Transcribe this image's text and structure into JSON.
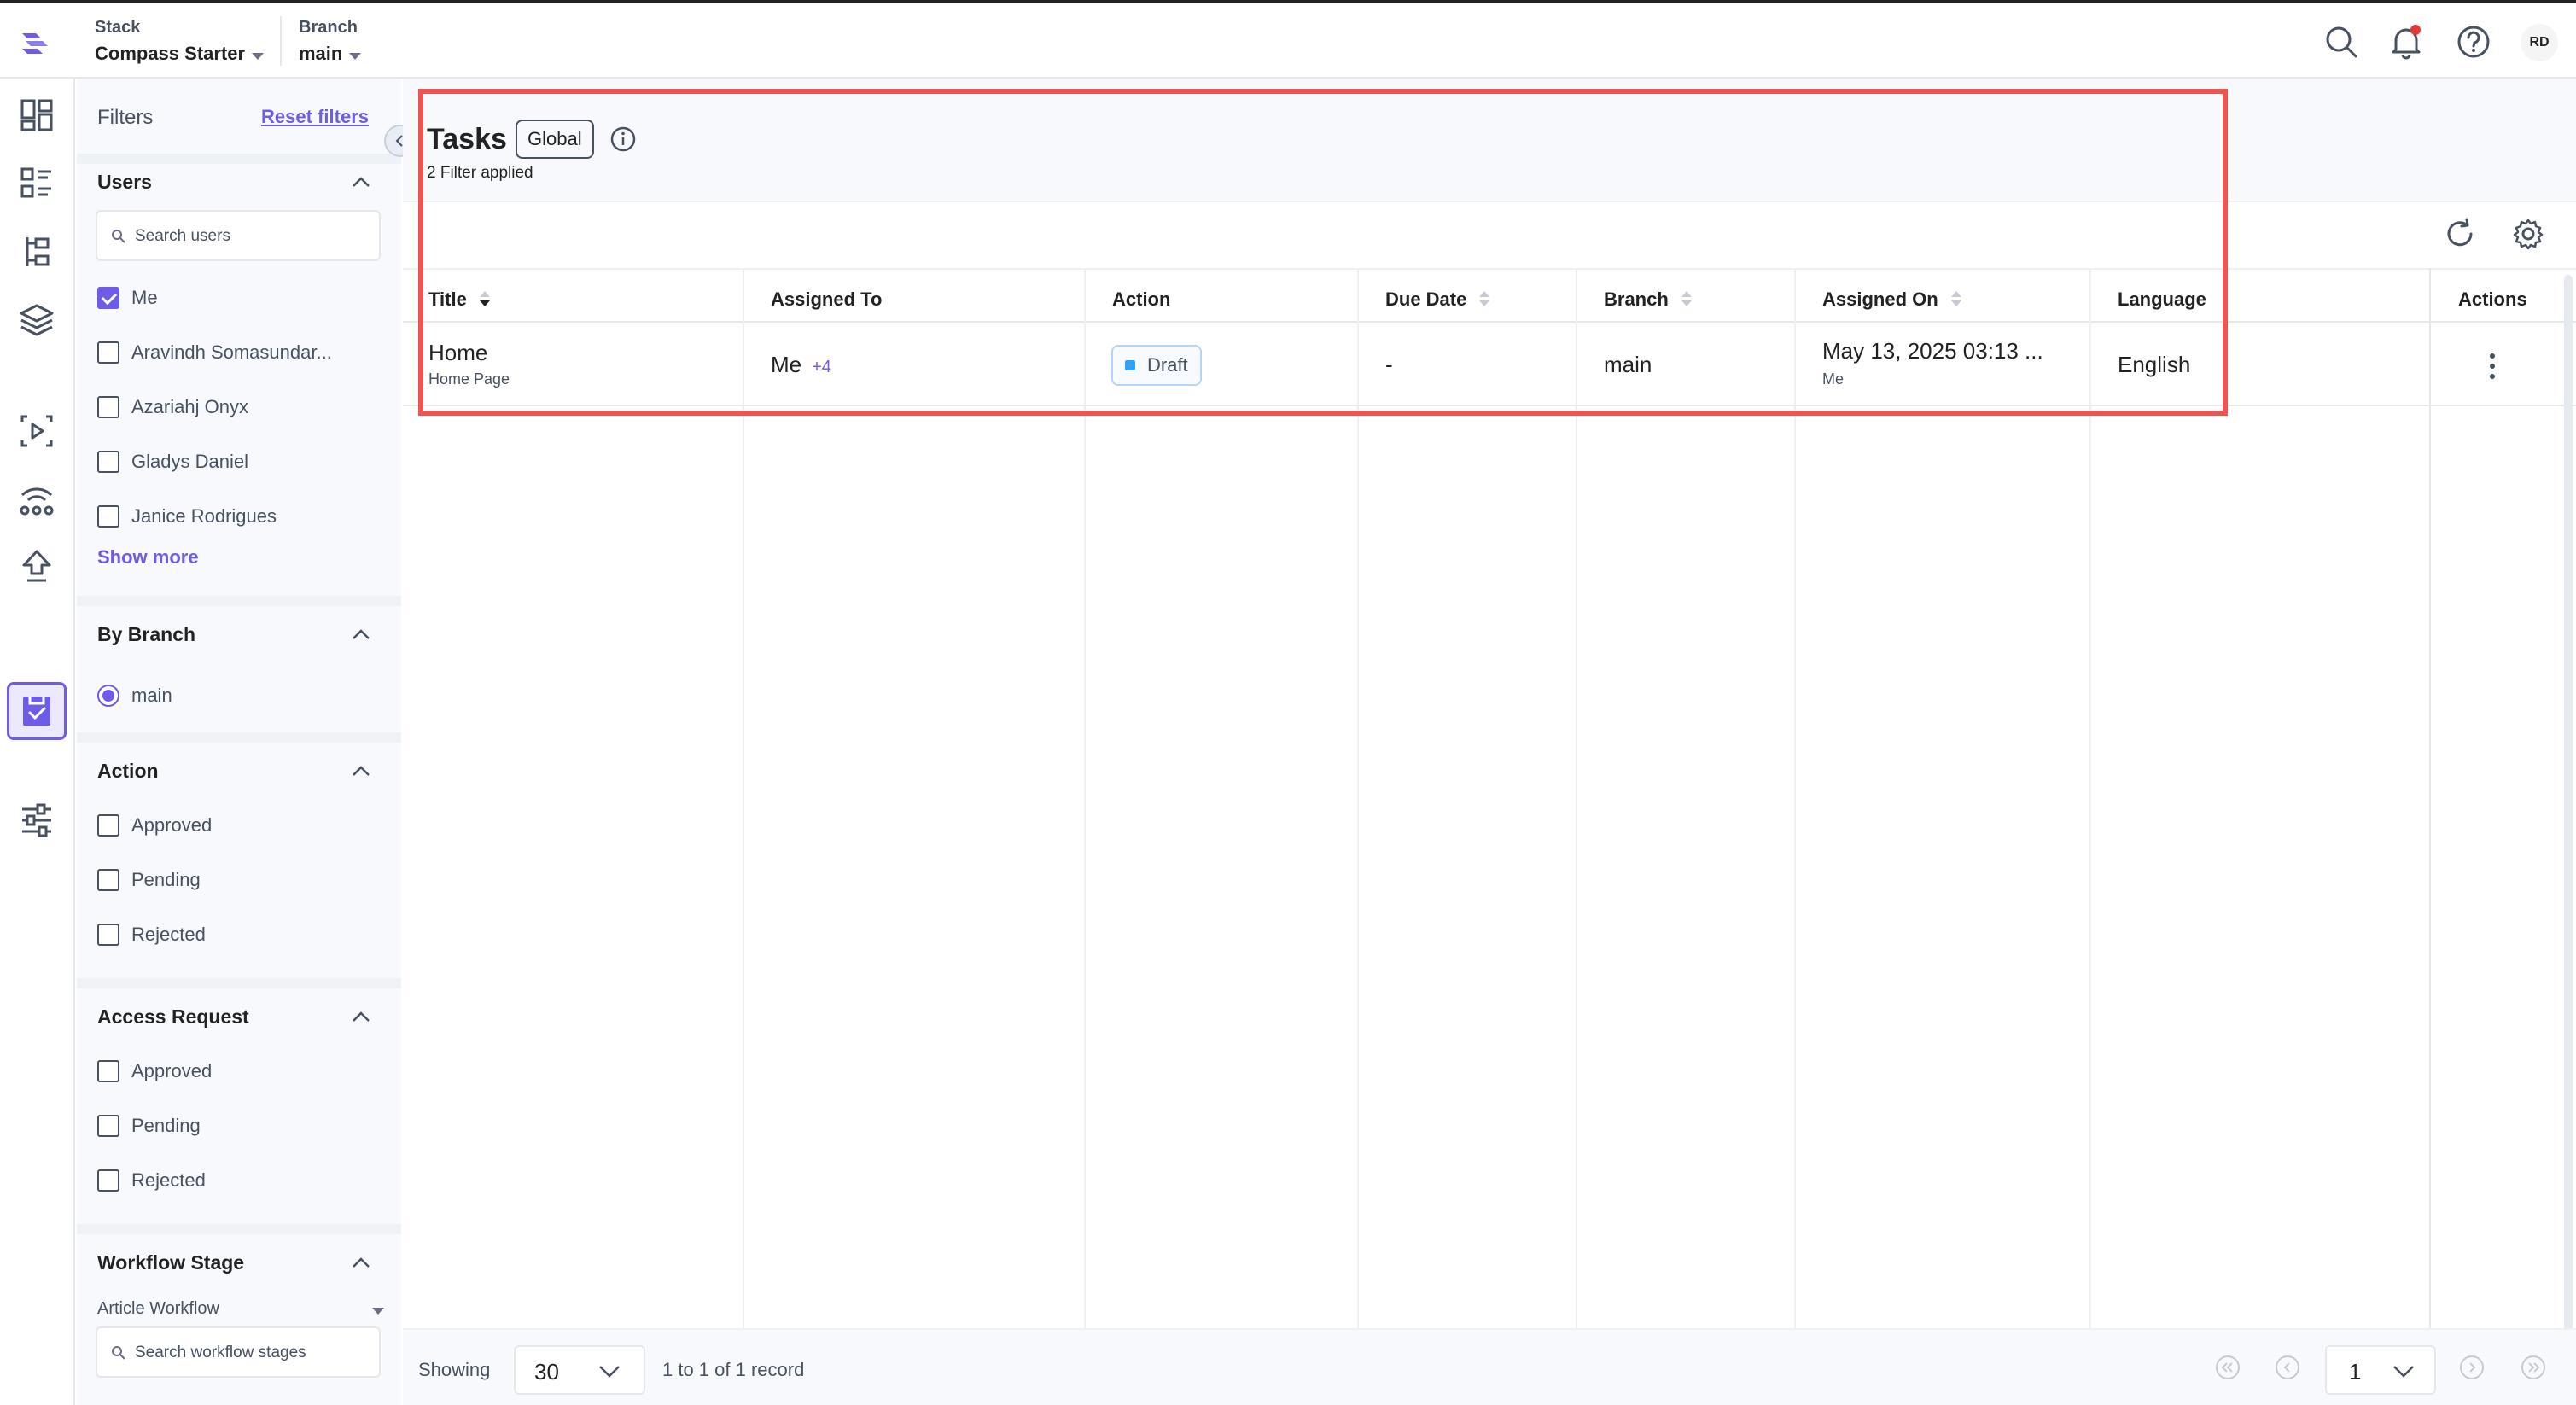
{
  "header": {
    "stack_label": "Stack",
    "stack_value": "Compass Starter",
    "branch_label": "Branch",
    "branch_value": "main",
    "avatar_initials": "RD",
    "notification_dot_color": "#e53935"
  },
  "filters": {
    "title": "Filters",
    "reset_label": "Reset filters",
    "users": {
      "title": "Users",
      "search_placeholder": "Search users",
      "items": [
        {
          "label": "Me",
          "checked": true
        },
        {
          "label": "Aravindh Somasundar...",
          "checked": false
        },
        {
          "label": "Azariahj Onyx",
          "checked": false
        },
        {
          "label": "Gladys Daniel",
          "checked": false
        },
        {
          "label": "Janice Rodrigues",
          "checked": false
        }
      ],
      "show_more": "Show more"
    },
    "by_branch": {
      "title": "By Branch",
      "items": [
        {
          "label": "main",
          "selected": true
        }
      ]
    },
    "action": {
      "title": "Action",
      "items": [
        {
          "label": "Approved"
        },
        {
          "label": "Pending"
        },
        {
          "label": "Rejected"
        }
      ]
    },
    "access_request": {
      "title": "Access Request",
      "items": [
        {
          "label": "Approved"
        },
        {
          "label": "Pending"
        },
        {
          "label": "Rejected"
        }
      ]
    },
    "workflow_stage": {
      "title": "Workflow Stage",
      "selected_workflow": "Article Workflow",
      "search_placeholder": "Search workflow stages"
    }
  },
  "main": {
    "title": "Tasks",
    "scope_badge": "Global",
    "filter_summary": "2 Filter applied",
    "columns": [
      "Title",
      "Assigned To",
      "Action",
      "Due Date",
      "Branch",
      "Assigned On",
      "Language",
      "Actions"
    ],
    "rows": [
      {
        "title": "Home",
        "title_sub": "Home Page",
        "assigned_to": "Me",
        "assigned_extra": "+4",
        "action": "Draft",
        "due_date": "-",
        "branch": "main",
        "assigned_on": "May 13, 2025 03:13 ...",
        "assigned_on_sub": "Me",
        "language": "English"
      }
    ]
  },
  "footer": {
    "showing_label": "Showing",
    "per_page": "30",
    "records_text": "1 to 1 of 1 record",
    "current_page": "1"
  },
  "colors": {
    "accent": "#6c5ce7",
    "highlight": "#ef5550",
    "draft_dot": "#2ea2ff"
  }
}
